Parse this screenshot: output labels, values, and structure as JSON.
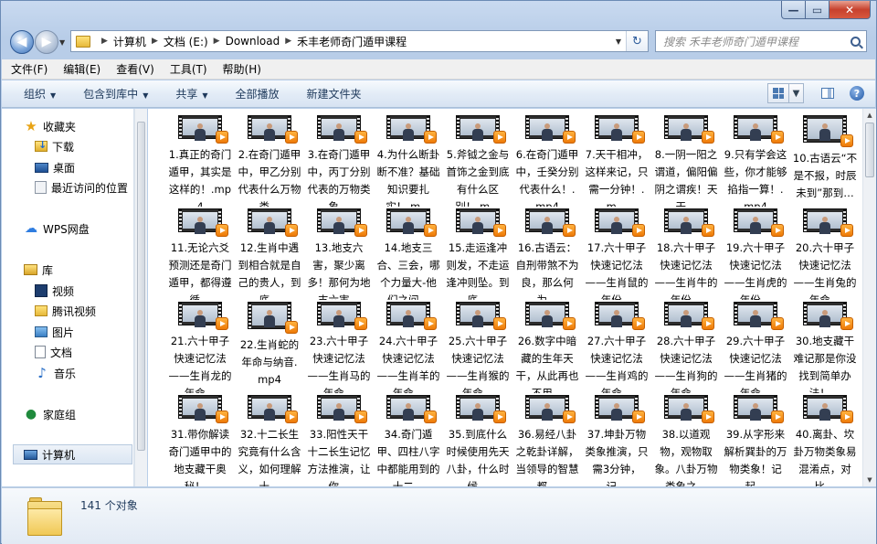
{
  "window": {
    "minimize": "—",
    "maximize": "▭",
    "close": "✕"
  },
  "nav": {
    "back": "◀",
    "forward": "▶",
    "recent_dropdown": "▼"
  },
  "breadcrumbs": [
    "计算机",
    "文档 (E:)",
    "Download",
    "禾丰老师奇门遁甲课程"
  ],
  "address": {
    "dropdown": "▼",
    "refresh": "↻"
  },
  "search": {
    "placeholder": "搜索 禾丰老师奇门遁甲课程"
  },
  "menu": [
    "文件(F)",
    "编辑(E)",
    "查看(V)",
    "工具(T)",
    "帮助(H)"
  ],
  "commands": [
    {
      "label": "组织",
      "dropdown": "▼"
    },
    {
      "label": "包含到库中",
      "dropdown": "▼"
    },
    {
      "label": "共享",
      "dropdown": "▼"
    },
    {
      "label": "全部播放",
      "dropdown": ""
    },
    {
      "label": "新建文件夹",
      "dropdown": ""
    }
  ],
  "view_dropdown": "▼",
  "help": "?",
  "sidebar": {
    "favorites": "收藏夹",
    "fav_items": [
      "下载",
      "桌面",
      "最近访问的位置"
    ],
    "wps": "WPS网盘",
    "library": "库",
    "lib_items": [
      "视频",
      "腾讯视频",
      "图片",
      "文档",
      "音乐"
    ],
    "homegroup": "家庭组",
    "computer": "计算机"
  },
  "files": [
    "1.真正的奇门遁甲，其实是这样的！.mp4",
    "2.在奇门遁甲中，甲乙分别代表什么万物类…",
    "3.在奇门遁甲中，丙丁分别代表的万物类象…",
    "4.为什么断卦断不准？基础知识要扎实！.m…",
    "5.斧钺之金与首饰之金到底有什么区别！.m…",
    "6.在奇门遁甲中，壬癸分别代表什么！.mp4",
    "7.天干相冲，这样来记，只需一分钟！.m…",
    "8.一阴一阳之谓道，偏阳偏阴之谓疾！天干…",
    "9.只有学会这些，你才能够掐指一算！.mp4",
    "10.古语云“不是不报，时辰未到”那到…",
    "11.无论六爻预测还是奇门遁甲，都得遵循…",
    "12.生肖中遇到相合就是自己的贵人，到底…",
    "13.地支六害，聚少离多！那何为地支六害…",
    "14.地支三合、三会，哪个力量大-他们之间…",
    "15.走运逢冲则发，不走运逢冲则坠。到底…",
    "16.古语云：自刑带煞不为良，那么何为…",
    "17.六十甲子快速记忆法——生肖鼠的年份…",
    "18.六十甲子快速记忆法——生肖牛的年份…",
    "19.六十甲子快速记忆法——生肖虎的年份…",
    "20.六十甲子快速记忆法——生肖兔的年命…",
    "21.六十甲子快速记忆法——生肖龙的年命…",
    "22.生肖蛇的年命与纳音.mp4",
    "23.六十甲子快速记忆法——生肖马的年命…",
    "24.六十甲子快速记忆法——生肖羊的年命…",
    "25.六十甲子快速记忆法——生肖猴的年命…",
    "26.数字中暗藏的生年天干，从此再也不用…",
    "27.六十甲子快速记忆法——生肖鸡的年命…",
    "28.六十甲子快速记忆法——生肖狗的年命…",
    "29.六十甲子快速记忆法——生肖猪的年命…",
    "30.地支藏干难记那是你没找到简单办法！…",
    "31.带你解读奇门遁甲中的地支藏干奥秘！…",
    "32.十二长生究竟有什么含义，如何理解十…",
    "33.阳性天干十二长生记忆方法推演，让你…",
    "34.奇门遁甲、四柱八字中都能用到的十二…",
    "35.到底什么时候使用先天八卦，什么时候…",
    "36.易经八卦之乾卦详解，当领导的智慧都…",
    "37.坤卦万物类象推演，只需3分钟，记…",
    "38.以道观物，观物取象。八卦万物类象之…",
    "39.从字形来解析巽卦的万物类象！记起…",
    "40.离卦、坎卦万物类象易混淆点，对比…"
  ],
  "status": {
    "count": "141 个对象"
  }
}
